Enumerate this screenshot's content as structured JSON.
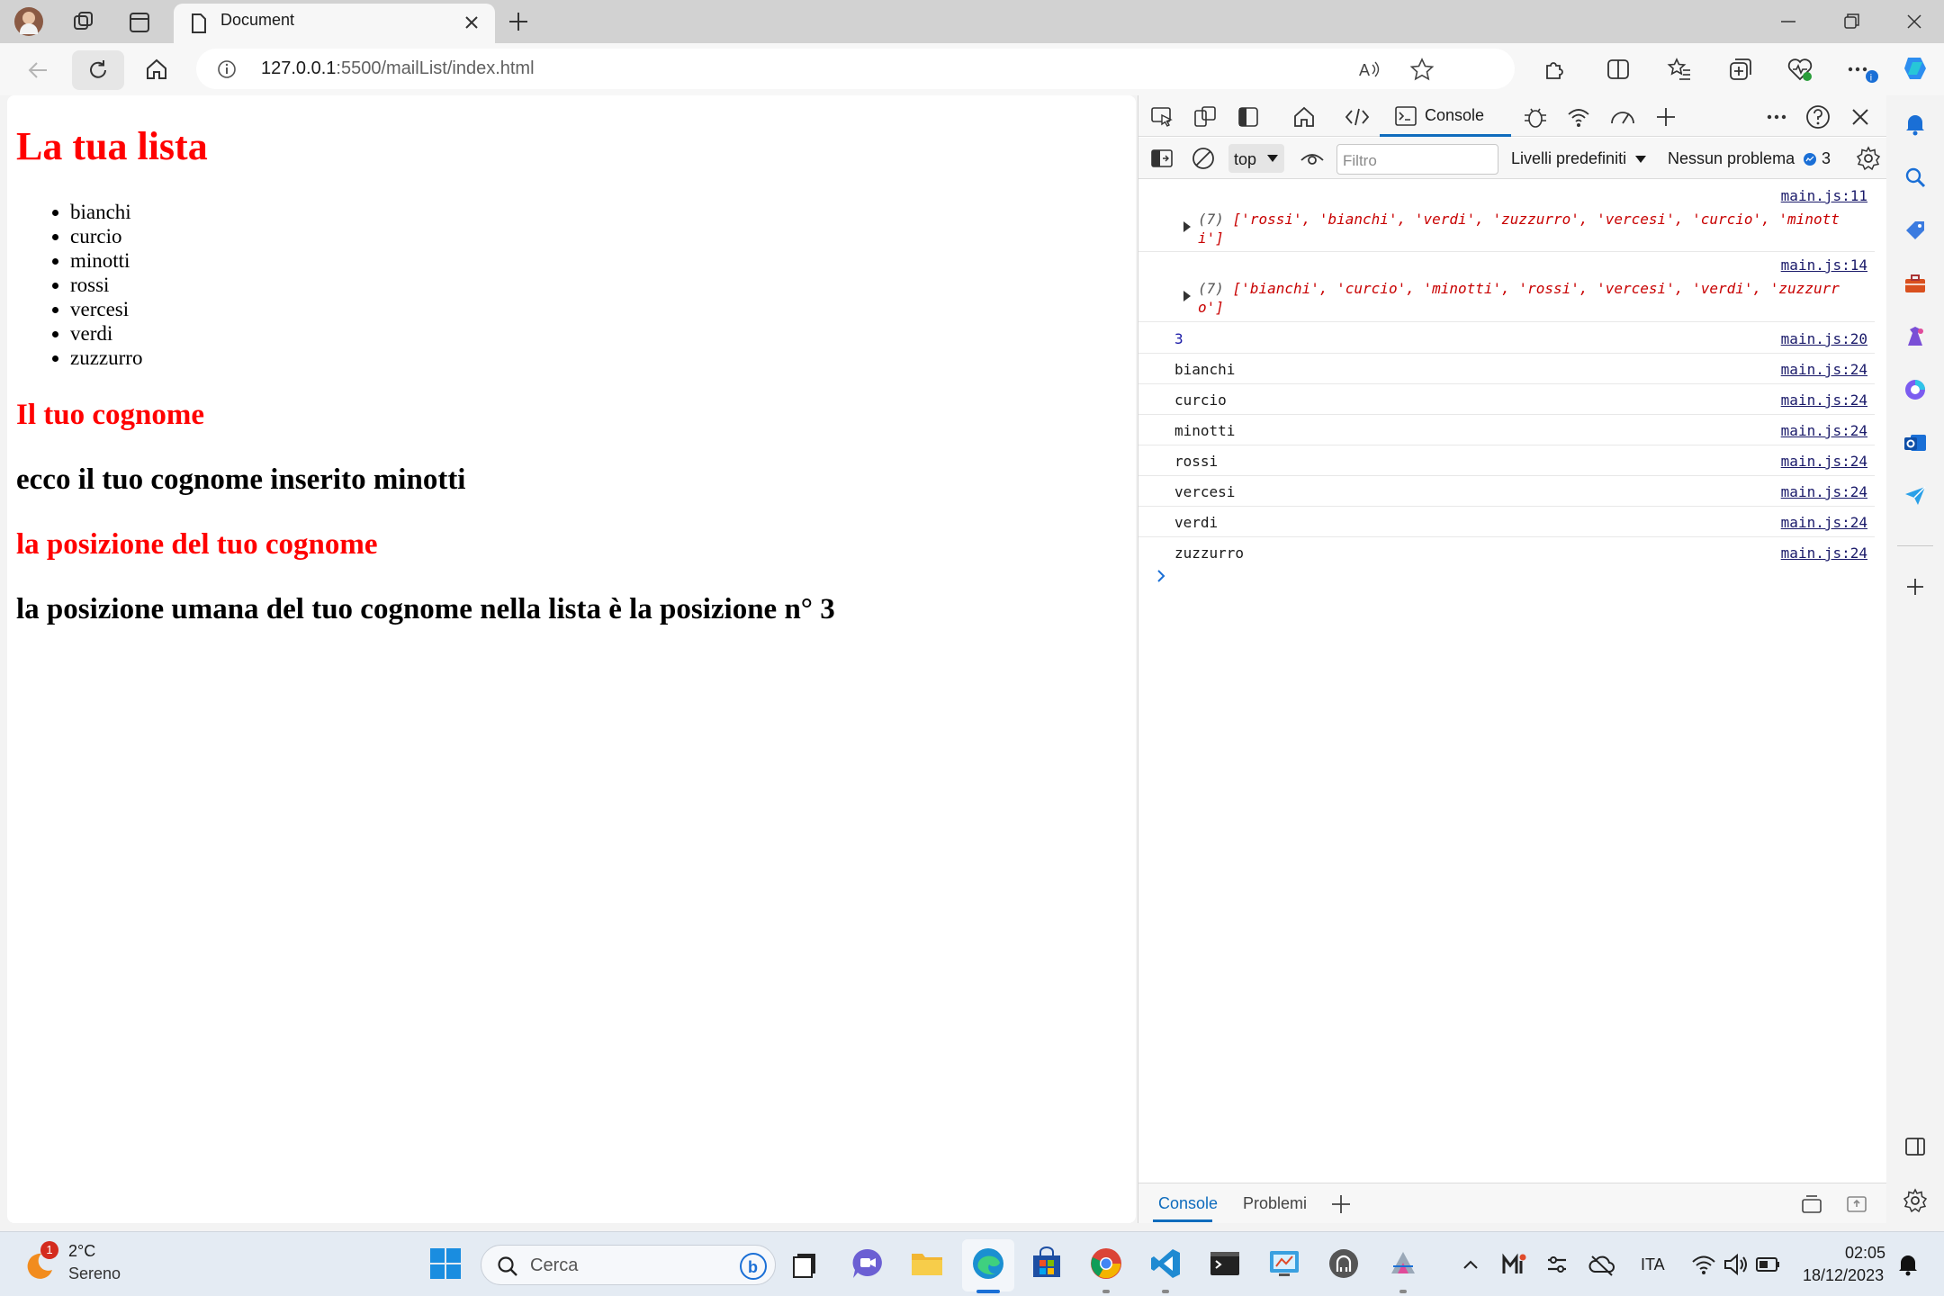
{
  "browser": {
    "tab_title": "Document",
    "url_host": "127.0.0.1",
    "url_path": ":5500/mailList/index.html"
  },
  "page": {
    "heading": "La tua lista",
    "list_items": [
      "bianchi",
      "curcio",
      "minotti",
      "rossi",
      "vercesi",
      "verdi",
      "zuzzurro"
    ],
    "surname_heading": "Il tuo cognome",
    "surname_text": "ecco il tuo cognome inserito minotti",
    "position_heading": "la posizione del tuo cognome",
    "position_text": "la posizione umana del tuo cognome nella lista è la posizione n° 3"
  },
  "devtools": {
    "console_tab": "Console",
    "context": "top",
    "filter_placeholder": "Filtro",
    "levels": "Livelli predefiniti",
    "issues": "Nessun problema",
    "issues_count": "3",
    "logs": [
      {
        "kind": "array",
        "count": "(7)",
        "text": "['rossi', 'bianchi', 'verdi', 'zuzzurro', 'vercesi', 'curcio', 'minotti']",
        "source": "main.js:11"
      },
      {
        "kind": "array",
        "count": "(7)",
        "text": "['bianchi', 'curcio', 'minotti', 'rossi', 'vercesi', 'verdi', 'zuzzurro']",
        "source": "main.js:14"
      },
      {
        "kind": "number",
        "text": "3",
        "source": "main.js:20"
      },
      {
        "kind": "text",
        "text": "bianchi",
        "source": "main.js:24"
      },
      {
        "kind": "text",
        "text": "curcio",
        "source": "main.js:24"
      },
      {
        "kind": "text",
        "text": "minotti",
        "source": "main.js:24"
      },
      {
        "kind": "text",
        "text": "rossi",
        "source": "main.js:24"
      },
      {
        "kind": "text",
        "text": "vercesi",
        "source": "main.js:24"
      },
      {
        "kind": "text",
        "text": "verdi",
        "source": "main.js:24"
      },
      {
        "kind": "text",
        "text": "zuzzurro",
        "source": "main.js:24"
      }
    ],
    "drawer_console": "Console",
    "drawer_problems": "Problemi"
  },
  "taskbar": {
    "weather_temp": "2°C",
    "weather_desc": "Sereno",
    "weather_badge": "1",
    "search_placeholder": "Cerca",
    "language": "ITA",
    "time": "02:05",
    "date": "18/12/2023"
  },
  "colors": {
    "heading_red": "#ff0000",
    "accent": "#0f6cbd",
    "console_string": "#c80000"
  }
}
